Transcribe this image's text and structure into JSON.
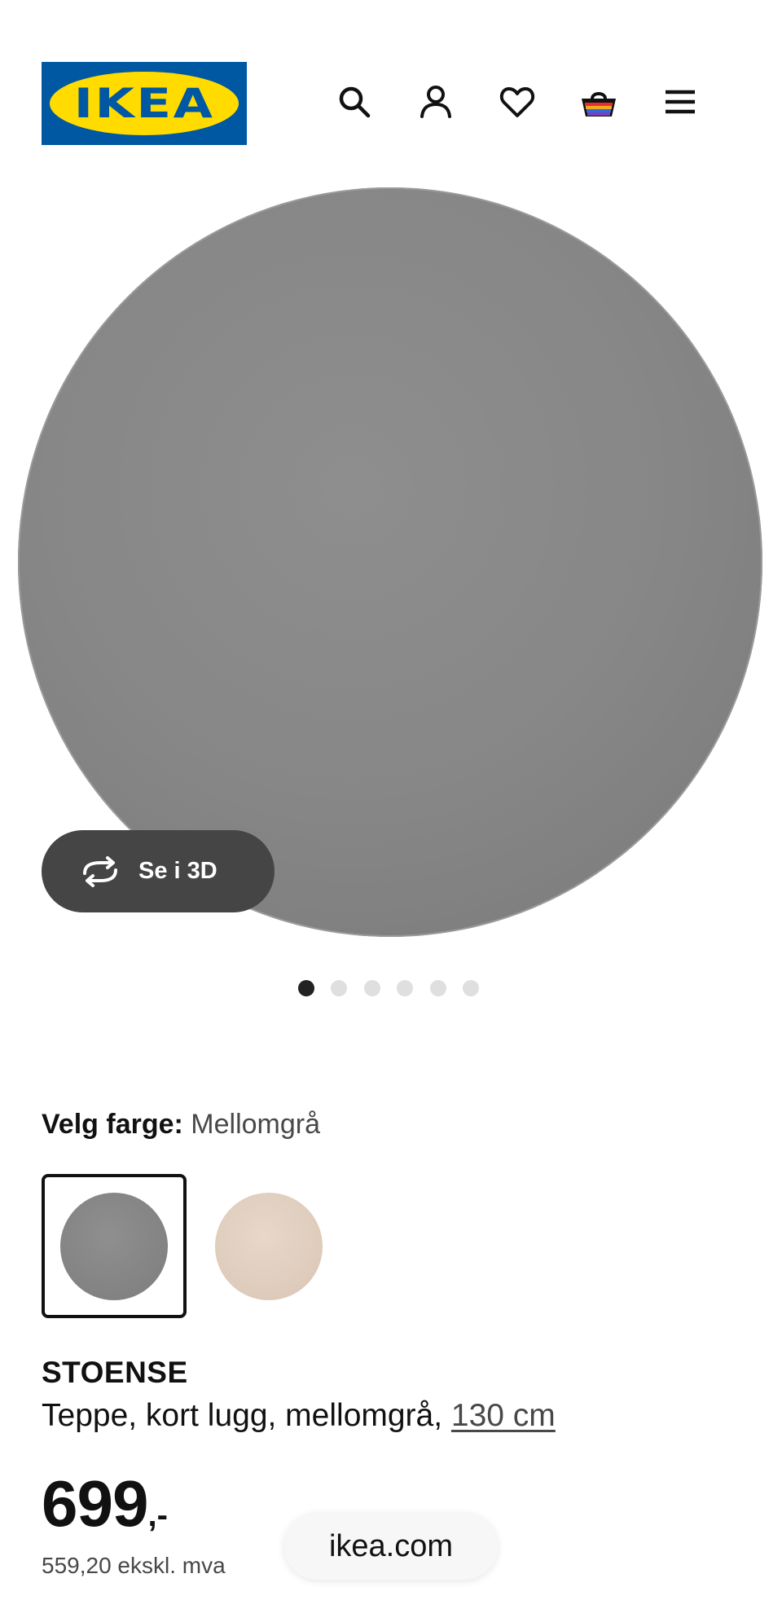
{
  "header": {
    "logo_text": "IKEA",
    "icons": [
      "search-icon",
      "user-icon",
      "heart-icon",
      "basket-icon",
      "menu-icon"
    ]
  },
  "gallery": {
    "view_3d_label": "Se i 3D",
    "dot_count": 6,
    "active_dot": 1
  },
  "color_picker": {
    "label": "Velg farge:",
    "selected_value": "Mellomgrå",
    "swatches": [
      {
        "name": "Mellomgrå",
        "color": "#888888",
        "selected": true
      },
      {
        "name": "Beige",
        "color": "#e1cfc0",
        "selected": false
      }
    ]
  },
  "product": {
    "name": "STOENSE",
    "description_prefix": "Teppe, kort lugg, mellomgrå, ",
    "size_link": "130 cm",
    "price_main": "699",
    "price_suffix": ",-",
    "price_ex_vat": "559,20 ekskl. mva"
  },
  "browser": {
    "url": "ikea.com"
  },
  "colors": {
    "ikea_blue": "#0058a3",
    "ikea_yellow": "#ffdb00",
    "rug_grey": "#888888",
    "button_dark": "#454545"
  }
}
